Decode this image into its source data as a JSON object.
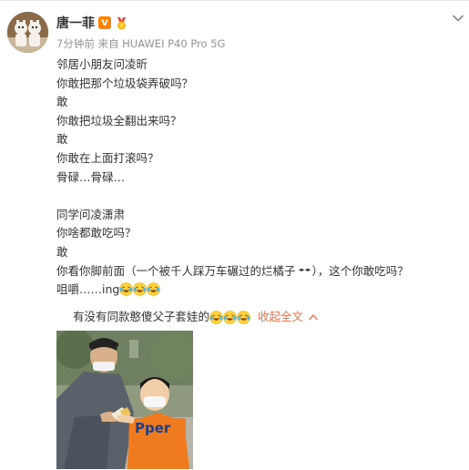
{
  "post": {
    "username": "唐一菲",
    "verified_badge": "V",
    "meta": "7分钟前 来自 HUAWEI P40 Pro 5G",
    "lines": [
      "邻居小朋友问凌昕",
      "你敢把那个垃圾袋弄破吗？",
      "敢",
      "你敢把垃圾全翻出来吗？",
      "敢",
      "你敢在上面打滚吗？",
      "骨碌…骨碌…",
      "",
      "同学问凌潇肃",
      "你啥都敢吃吗？",
      "敢"
    ],
    "line_long": "你看你脚前面（一个被千人踩万车碾过的烂橘子",
    "line_long_tail": "），这个你敢吃吗？",
    "line_last": "咀嚼……ing",
    "summary": "有没有同款憨傻父子套娃的",
    "collapse_label": "收起全文",
    "photo_shirt_text": "Pper",
    "icons": {
      "options": "chevron-down-icon",
      "medal": "medal-icon",
      "laugh_emoji": "laugh-cry-emoji",
      "collapse": "chevron-up-icon"
    },
    "colors": {
      "link": "#eb7350",
      "verified": "#ff8200",
      "meta": "#939393"
    }
  }
}
